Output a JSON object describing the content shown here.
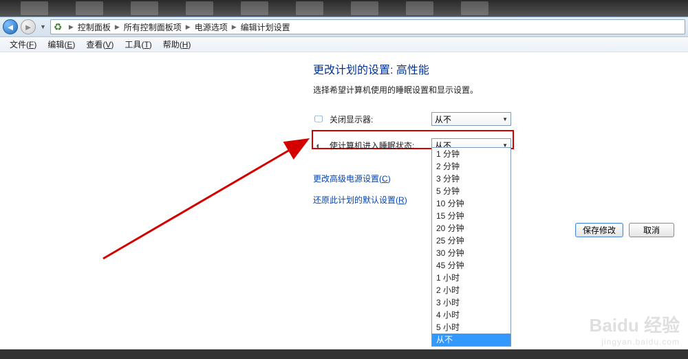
{
  "breadcrumb": {
    "items": [
      "控制面板",
      "所有控制面板项",
      "电源选项",
      "编辑计划设置"
    ]
  },
  "menu": {
    "file": "文件",
    "file_u": "F",
    "edit": "编辑",
    "edit_u": "E",
    "view": "查看",
    "view_u": "V",
    "tools": "工具",
    "tools_u": "T",
    "help": "帮助",
    "help_u": "H"
  },
  "page": {
    "title": "更改计划的设置: 高性能",
    "desc": "选择希望计算机使用的睡眠设置和显示设置。"
  },
  "settings": {
    "display_off": {
      "label": "关闭显示器:",
      "value": "从不"
    },
    "sleep": {
      "label": "使计算机进入睡眠状态:",
      "value": "从不"
    }
  },
  "dropdown_options": [
    "1 分钟",
    "2 分钟",
    "3 分钟",
    "5 分钟",
    "10 分钟",
    "15 分钟",
    "20 分钟",
    "25 分钟",
    "30 分钟",
    "45 分钟",
    "1 小时",
    "2 小时",
    "3 小时",
    "4 小时",
    "5 小时",
    "从不"
  ],
  "links": {
    "advanced": "更改高级电源设置",
    "advanced_u": "C",
    "restore": "还原此计划的默认设置",
    "restore_u": "R"
  },
  "buttons": {
    "save": "保存修改",
    "cancel": "取消"
  },
  "watermark": {
    "line1": "Baidu 经验",
    "line2": "jingyan.baidu.com"
  }
}
